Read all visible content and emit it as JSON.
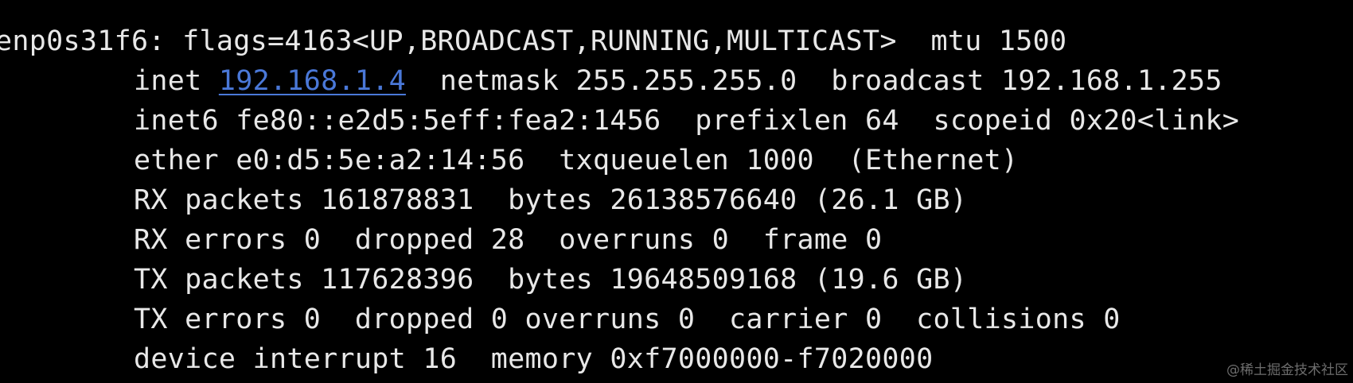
{
  "terminal": {
    "line1": "enp0s31f6: flags=4163<UP,BROADCAST,RUNNING,MULTICAST>  mtu 1500",
    "line2_prefix": "inet ",
    "line2_ip": "192.168.1.4",
    "line2_suffix": "  netmask 255.255.255.0  broadcast 192.168.1.255",
    "line3": "inet6 fe80::e2d5:5eff:fea2:1456  prefixlen 64  scopeid 0x20<link>",
    "line4": "ether e0:d5:5e:a2:14:56  txqueuelen 1000  (Ethernet)",
    "line5": "RX packets 161878831  bytes 26138576640 (26.1 GB)",
    "line6": "RX errors 0  dropped 28  overruns 0  frame 0",
    "line7": "TX packets 117628396  bytes 19648509168 (19.6 GB)",
    "line8": "TX errors 0  dropped 0 overruns 0  carrier 0  collisions 0",
    "line9": "device interrupt 16  memory 0xf7000000-f7020000"
  },
  "watermark": "@稀土掘金技术社区",
  "colors": {
    "background": "#000000",
    "text": "#e8e8e8",
    "link": "#4a78d8",
    "watermark": "#6d6d6d"
  }
}
